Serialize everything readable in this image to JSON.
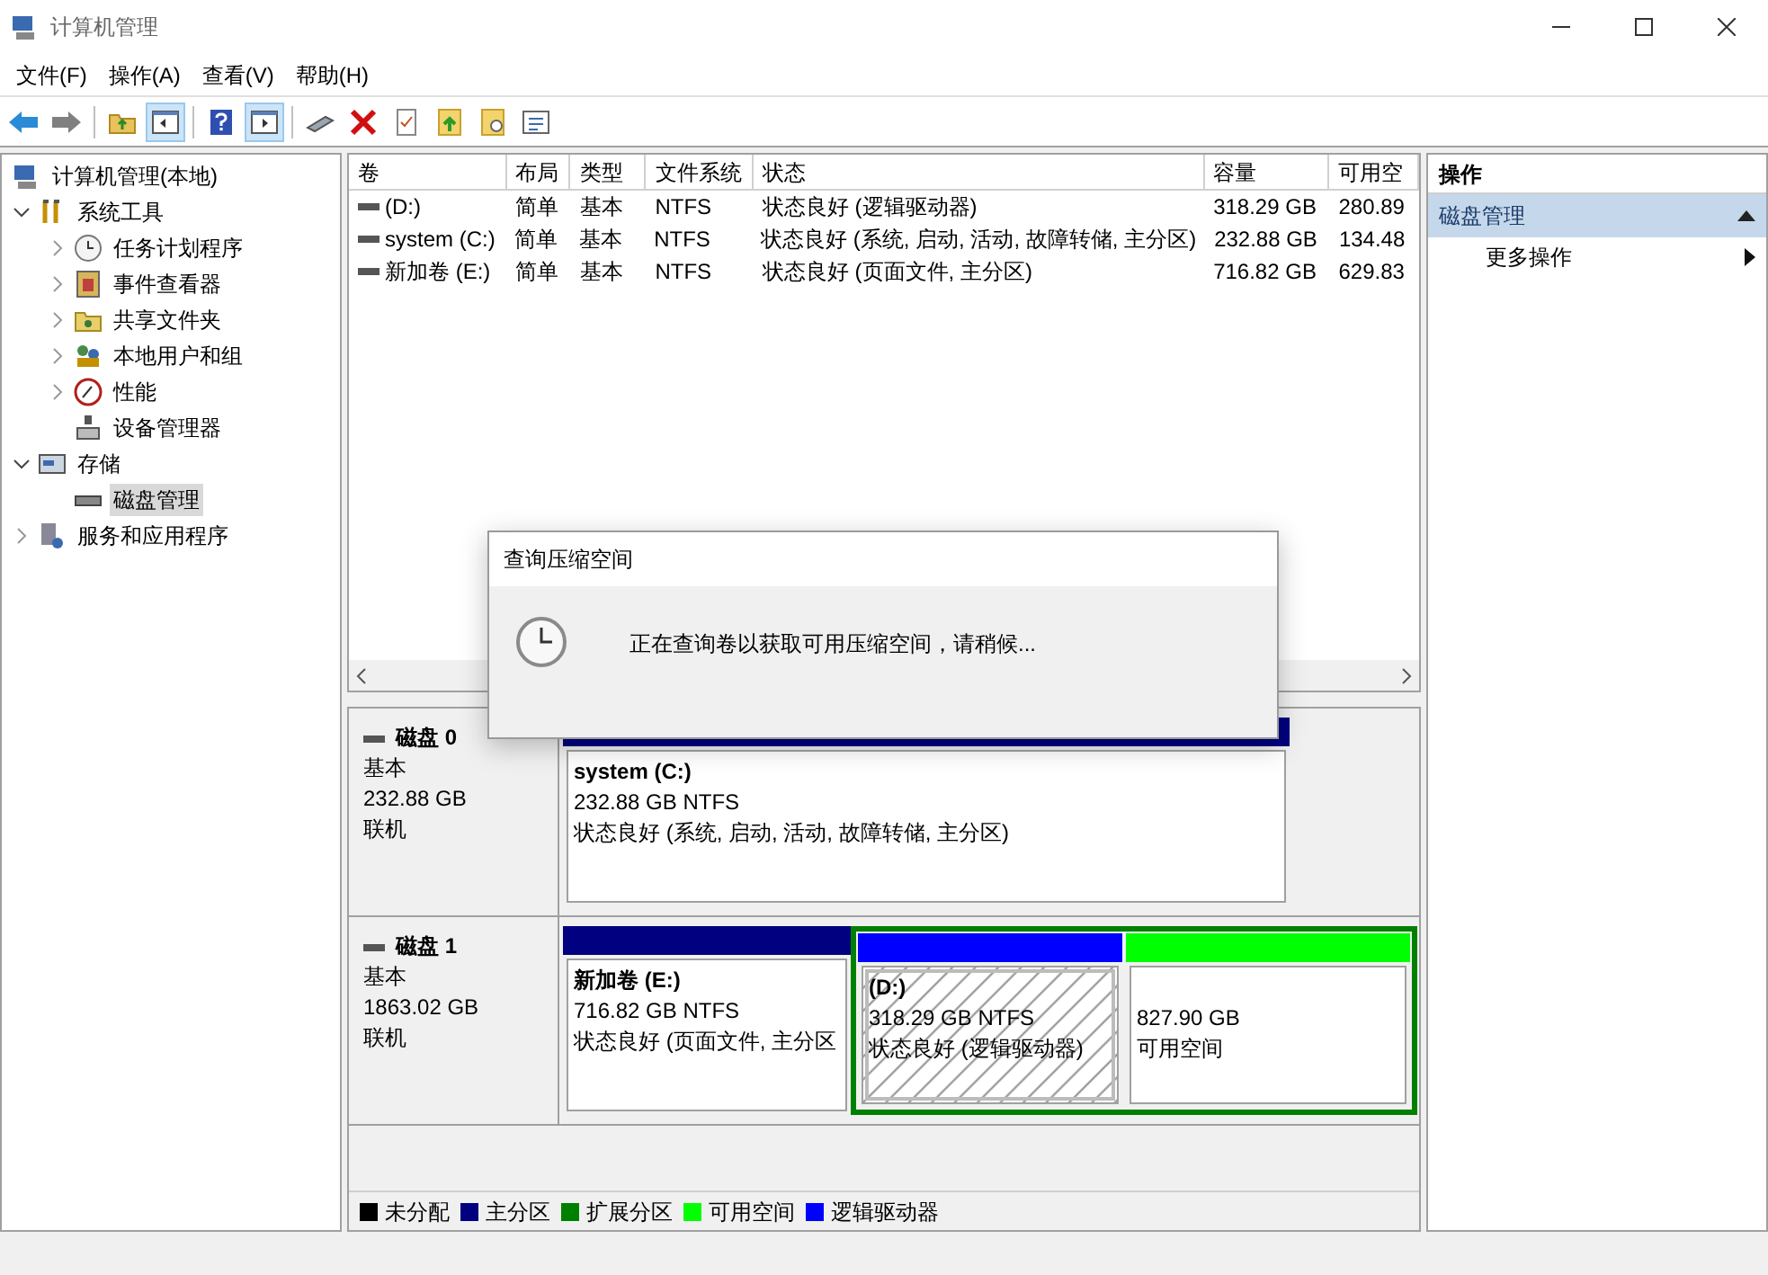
{
  "window": {
    "title": "计算机管理"
  },
  "menu": [
    "文件(F)",
    "操作(A)",
    "查看(V)",
    "帮助(H)"
  ],
  "toolbar": [
    {
      "kind": "back",
      "pressed": false
    },
    {
      "kind": "forward",
      "pressed": false
    },
    {
      "kind": "up",
      "pressed": false
    },
    {
      "kind": "tree",
      "pressed": true
    },
    {
      "kind": "help",
      "pressed": false
    },
    {
      "kind": "pane",
      "pressed": true
    },
    {
      "kind": "drive",
      "pressed": false
    },
    {
      "kind": "delete",
      "pressed": false
    },
    {
      "kind": "check",
      "pressed": false
    },
    {
      "kind": "folder-up",
      "pressed": false
    },
    {
      "kind": "folder-search",
      "pressed": false
    },
    {
      "kind": "list",
      "pressed": false
    }
  ],
  "tree": [
    {
      "label": "计算机管理(本地)",
      "selected": false
    },
    {
      "label": "系统工具",
      "expanded": true,
      "selected": false,
      "children": [
        {
          "label": "任务计划程序",
          "expanded": false,
          "selected": false
        },
        {
          "label": "事件查看器",
          "expanded": false,
          "selected": false
        },
        {
          "label": "共享文件夹",
          "expanded": false,
          "selected": false
        },
        {
          "label": "本地用户和组",
          "expanded": false,
          "selected": false
        },
        {
          "label": "性能",
          "expanded": false,
          "selected": false
        },
        {
          "label": "设备管理器",
          "selected": false
        }
      ]
    },
    {
      "label": "存储",
      "expanded": true,
      "selected": false,
      "children": [
        {
          "label": "磁盘管理",
          "selected": true
        }
      ]
    },
    {
      "label": "服务和应用程序",
      "expanded": false,
      "selected": false
    }
  ],
  "table": {
    "columns": [
      "卷",
      "布局",
      "类型",
      "文件系统",
      "状态",
      "容量",
      "可用空"
    ],
    "rows": [
      [
        "(D:)",
        "简单",
        "基本",
        "NTFS",
        "状态良好 (逻辑驱动器)",
        "318.29 GB",
        "280.89"
      ],
      [
        "system (C:)",
        "简单",
        "基本",
        "NTFS",
        "状态良好 (系统, 启动, 活动, 故障转储, 主分区)",
        "232.88 GB",
        "134.48"
      ],
      [
        "新加卷 (E:)",
        "简单",
        "基本",
        "NTFS",
        "状态良好 (页面文件, 主分区)",
        "716.82 GB",
        "629.83"
      ]
    ]
  },
  "disks": [
    {
      "name": "磁盘 0",
      "type": "基本",
      "size": "232.88 GB",
      "status": "联机",
      "partitions": [
        {
          "kind": "partition",
          "title": "system  (C:)",
          "size": "232.88 GB NTFS",
          "status": "状态良好 (系统, 启动, 活动, 故障转储, 主分区)",
          "color": "#000080",
          "selected": false
        }
      ]
    },
    {
      "name": "磁盘 1",
      "type": "基本",
      "size": "1863.02 GB",
      "status": "联机",
      "partitions": [
        {
          "kind": "partition",
          "title": "新加卷  (E:)",
          "size": "716.82 GB NTFS",
          "status": "状态良好 (页面文件, 主分区",
          "color": "#000080",
          "selected": false
        },
        {
          "kind": "extended",
          "color": "#008000",
          "children": [
            {
              "kind": "partition",
              "title": "(D:)",
              "size": "318.29 GB NTFS",
              "status": "状态良好 (逻辑驱动器)",
              "color": "#0000ff",
              "selected": true
            },
            {
              "kind": "free",
              "size": "827.90 GB",
              "status": "可用空间",
              "color": "#00ff00",
              "selected": false
            }
          ]
        }
      ]
    }
  ],
  "legend": [
    {
      "label": "未分配",
      "color": "#000000"
    },
    {
      "label": "主分区",
      "color": "#000080"
    },
    {
      "label": "扩展分区",
      "color": "#008000"
    },
    {
      "label": "可用空间",
      "color": "#00ff00"
    },
    {
      "label": "逻辑驱动器",
      "color": "#0000ff"
    }
  ],
  "actions": {
    "heading": "操作",
    "section": {
      "label": "磁盘管理",
      "expanded": true
    },
    "items": [
      "更多操作"
    ]
  },
  "dialog": {
    "title": "查询压缩空间",
    "message": "正在查询卷以获取可用压缩空间，请稍候..."
  }
}
